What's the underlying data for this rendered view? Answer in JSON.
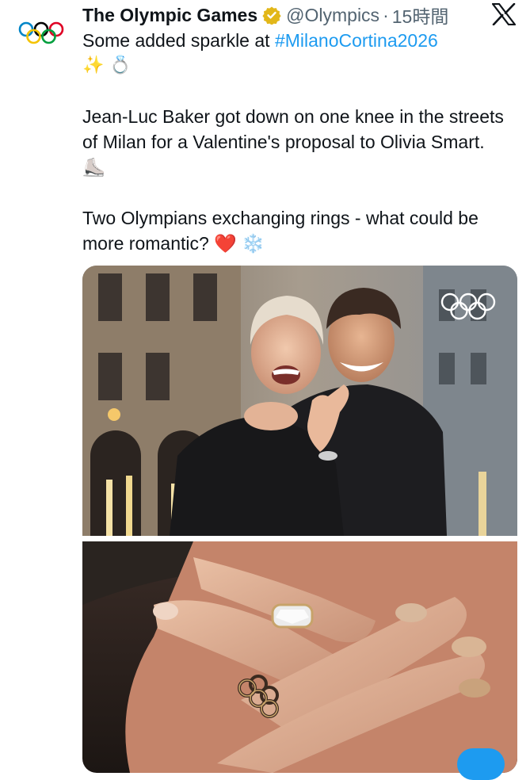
{
  "tweet": {
    "author_name": "The Olympic Games",
    "handle": "@Olympics",
    "separator": "·",
    "time": "15時間",
    "line1_prefix": "Some added sparkle at ",
    "hashtag": "#MilanoCortina2026",
    "line1_emoji": "✨ 💍",
    "para2": "Jean-Luc Baker got down on one knee in the streets of Milan for a Valentine's proposal to Olivia Smart. ⛸️",
    "para3": "Two Olympians exchanging rings - what could be more romantic? ❤️ ❄️"
  },
  "icons": {
    "avatar": "olympic-rings-icon",
    "verified": "verified-badge-icon",
    "platform": "x-logo-icon"
  },
  "colors": {
    "text": "#0f1419",
    "secondary": "#536471",
    "link": "#1d9bf0",
    "verified_gold": "#e2b719"
  }
}
